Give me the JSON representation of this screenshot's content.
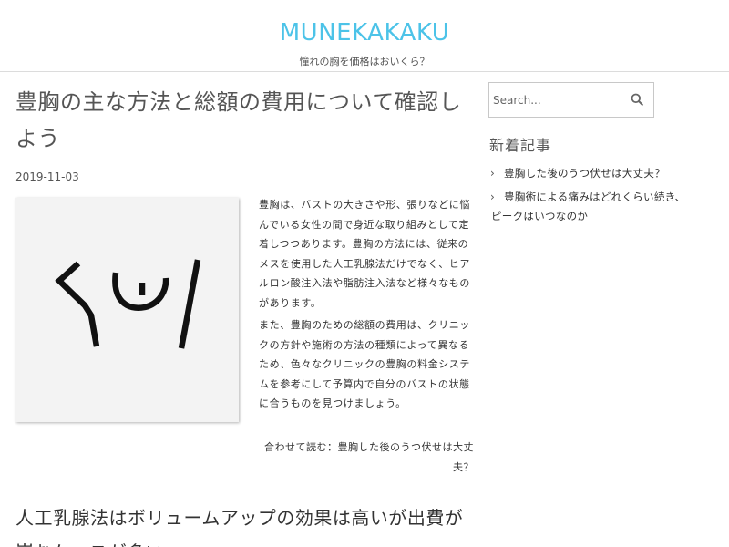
{
  "header": {
    "site_title": "MUNEKAKAKU",
    "tagline": "憧れの胸を価格はおいくら？"
  },
  "post": {
    "title": "豊胸の主な方法と総額の費用について確認しよう",
    "date": "2019-11-03",
    "paragraph1": "豊胸は、バストの大きさや形、張りなどに悩んでいる女性の間で身近な取り組みとして定着しつつあります。豊胸の方法には、従来のメスを使用した人工乳腺法だけでなく、ヒアルロン酸注入法や脂肪注入法など様々なものがあります。",
    "paragraph2": "また、豊胸のための総額の費用は、クリニックの方針や施術の方法の種類によって異なるため、色々なクリニックの豊胸の料金システムを参考にして予算内で自分のバストの状態に合うものを見つけましょう。",
    "related_link": "合わせて読む：豊胸した後のうつ伏せは大丈夫？",
    "section_heading": "人工乳腺法はボリュームアップの効果は高いが出費が嵩むケースが多い"
  },
  "sidebar": {
    "search": {
      "placeholder": "Search...",
      "icon": "search-icon"
    },
    "widget_title": "新着記事",
    "recent_posts": [
      {
        "line1": "豊胸した後のうつ伏せは大丈夫？",
        "line2": ""
      },
      {
        "line1": "豊胸術による痛みはどれくらい続き、",
        "line2": "ピークはいつなのか"
      }
    ]
  },
  "colors": {
    "site_title": "#4cc3e8",
    "text": "#333333",
    "border": "#dcdcdc"
  }
}
